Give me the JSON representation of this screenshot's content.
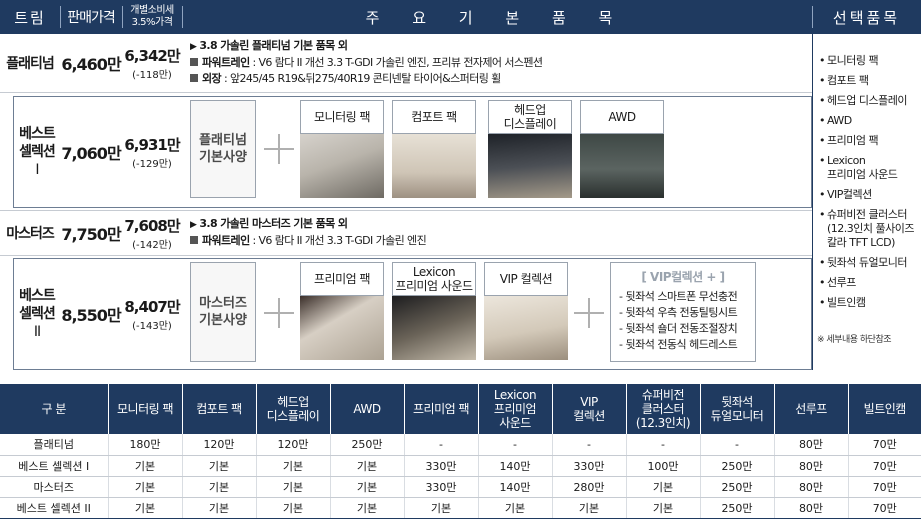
{
  "header": {
    "trim": "트림",
    "price": "판매가격",
    "indiv_line1": "개별소비세",
    "indiv_line2": "3.5%가격",
    "main": "주 요 기 본 품 목",
    "options": "선택품목"
  },
  "rows": {
    "platinum": {
      "trim": "플래티넘",
      "price": "6,460만",
      "ind": "6,342만",
      "diff": "(-118만)",
      "title": "3.8 가솔린 플래티넘 기본 품목 외",
      "pt_label": "파워트레인",
      "pt_text": " : V6 람다 II  개선 3.3 T-GDI 가솔린 엔진, 프리뷰 전자제어 서스펜션",
      "ext_label": "외장",
      "ext_text": " : 앞245/45 R19&뒤275/40R19 콘티넨탈 타이어&스퍼터링 휠"
    },
    "best1": {
      "trim1": "베스트",
      "trim2": "셀렉션",
      "trim3": "I",
      "price": "7,060만",
      "ind": "6,931만",
      "diff": "(-129만)",
      "base1": "플래티넘",
      "base2": "기본사양",
      "packs": [
        "모니터링 팩",
        "컴포트 팩",
        "헤드업\n디스플레이",
        "AWD"
      ]
    },
    "masters": {
      "trim": "마스터즈",
      "price": "7,750만",
      "ind": "7,608만",
      "diff": "(-142만)",
      "title": "3.8 가솔린 마스터즈 기본 품목 외",
      "pt_label": "파워트레인",
      "pt_text": " : V6 람다 II  개선 3.3 T-GDI 가솔린 엔진"
    },
    "best2": {
      "trim1": "베스트",
      "trim2": "셀렉션",
      "trim3": "II",
      "price": "8,550만",
      "ind": "8,407만",
      "diff": "(-143만)",
      "base1": "마스터즈",
      "base2": "기본사양",
      "packs": [
        "프리미엄 팩",
        "Lexicon\n프리미엄 사운드",
        "VIP 컬렉션"
      ],
      "vip_title": "[ VIP컬렉션 + ]",
      "vip_items": [
        "- 뒷좌석 스마트폰 무선충전",
        "- 뒷좌석 우측 전동틸팅시트",
        "- 뒷좌석 숄더 전동조절장치",
        "- 뒷좌석 전동식 헤드레스트"
      ]
    }
  },
  "options": {
    "items": [
      "모니터링 팩",
      "컴포트 팩",
      "헤드업 디스플레이",
      "AWD",
      "프리미엄 팩",
      "Lexicon\n프리미엄 사운드",
      "VIP컬렉션",
      "슈퍼비전 클러스터\n(12.3인치 풀사이즈\n칼라 TFT LCD)",
      "뒷좌석 듀얼모니터",
      "선루프",
      "빌트인캠"
    ],
    "note": "※ 세부내용 하단참조"
  },
  "table": {
    "headers": [
      "구 분",
      "모니터링 팩",
      "컴포트 팩",
      "헤드업\n디스플레이",
      "AWD",
      "프리미엄 팩",
      "Lexicon\n프리미엄\n사운드",
      "VIP\n컬렉션",
      "슈퍼비전\n클러스터\n(12.3인치)",
      "뒷좌석\n듀얼모니터",
      "선루프",
      "빌트인캠"
    ],
    "rows": [
      [
        "플래티넘",
        "180만",
        "120만",
        "120만",
        "250만",
        "-",
        "-",
        "-",
        "-",
        "-",
        "80만",
        "70만"
      ],
      [
        "베스트 셀렉션 I",
        "기본",
        "기본",
        "기본",
        "기본",
        "330만",
        "140만",
        "330만",
        "100만",
        "250만",
        "80만",
        "70만"
      ],
      [
        "마스터즈",
        "기본",
        "기본",
        "기본",
        "기본",
        "330만",
        "140만",
        "280만",
        "기본",
        "250만",
        "80만",
        "70만"
      ],
      [
        "베스트 셀렉션 II",
        "기본",
        "기본",
        "기본",
        "기본",
        "기본",
        "기본",
        "기본",
        "기본",
        "250만",
        "80만",
        "70만"
      ]
    ]
  },
  "colors": {
    "navy": "#1f3a60",
    "border": "#6d7d93"
  }
}
